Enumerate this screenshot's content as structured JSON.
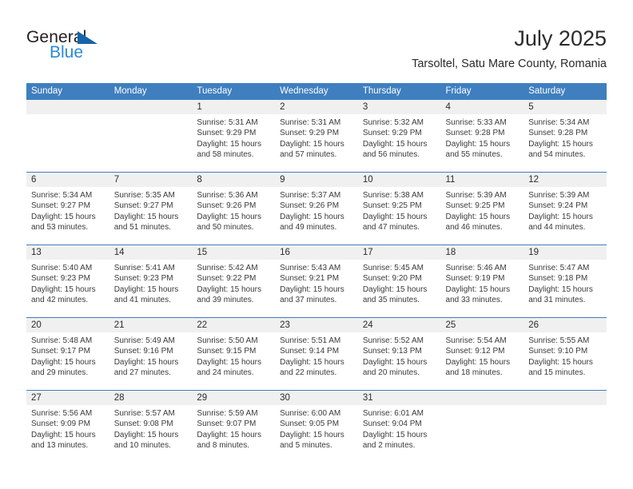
{
  "brand": {
    "name_top": "General",
    "name_bottom": "Blue",
    "triangle_icon": "brand-triangle-icon",
    "color_black": "#231f20",
    "color_blue": "#2a8ad4"
  },
  "header": {
    "title": "July 2025",
    "location": "Tarsoltel, Satu Mare County, Romania"
  },
  "theme": {
    "header_blue": "#3f7fbf",
    "row_gray": "#f0f0f0",
    "text": "#3a3a3a"
  },
  "weekdays": [
    "Sunday",
    "Monday",
    "Tuesday",
    "Wednesday",
    "Thursday",
    "Friday",
    "Saturday"
  ],
  "weeks": [
    [
      {
        "day": "",
        "sunrise": "",
        "sunset": "",
        "daylight_line1": "",
        "daylight_line2": ""
      },
      {
        "day": "",
        "sunrise": "",
        "sunset": "",
        "daylight_line1": "",
        "daylight_line2": ""
      },
      {
        "day": "1",
        "sunrise": "Sunrise: 5:31 AM",
        "sunset": "Sunset: 9:29 PM",
        "daylight_line1": "Daylight: 15 hours",
        "daylight_line2": "and 58 minutes."
      },
      {
        "day": "2",
        "sunrise": "Sunrise: 5:31 AM",
        "sunset": "Sunset: 9:29 PM",
        "daylight_line1": "Daylight: 15 hours",
        "daylight_line2": "and 57 minutes."
      },
      {
        "day": "3",
        "sunrise": "Sunrise: 5:32 AM",
        "sunset": "Sunset: 9:29 PM",
        "daylight_line1": "Daylight: 15 hours",
        "daylight_line2": "and 56 minutes."
      },
      {
        "day": "4",
        "sunrise": "Sunrise: 5:33 AM",
        "sunset": "Sunset: 9:28 PM",
        "daylight_line1": "Daylight: 15 hours",
        "daylight_line2": "and 55 minutes."
      },
      {
        "day": "5",
        "sunrise": "Sunrise: 5:34 AM",
        "sunset": "Sunset: 9:28 PM",
        "daylight_line1": "Daylight: 15 hours",
        "daylight_line2": "and 54 minutes."
      }
    ],
    [
      {
        "day": "6",
        "sunrise": "Sunrise: 5:34 AM",
        "sunset": "Sunset: 9:27 PM",
        "daylight_line1": "Daylight: 15 hours",
        "daylight_line2": "and 53 minutes."
      },
      {
        "day": "7",
        "sunrise": "Sunrise: 5:35 AM",
        "sunset": "Sunset: 9:27 PM",
        "daylight_line1": "Daylight: 15 hours",
        "daylight_line2": "and 51 minutes."
      },
      {
        "day": "8",
        "sunrise": "Sunrise: 5:36 AM",
        "sunset": "Sunset: 9:26 PM",
        "daylight_line1": "Daylight: 15 hours",
        "daylight_line2": "and 50 minutes."
      },
      {
        "day": "9",
        "sunrise": "Sunrise: 5:37 AM",
        "sunset": "Sunset: 9:26 PM",
        "daylight_line1": "Daylight: 15 hours",
        "daylight_line2": "and 49 minutes."
      },
      {
        "day": "10",
        "sunrise": "Sunrise: 5:38 AM",
        "sunset": "Sunset: 9:25 PM",
        "daylight_line1": "Daylight: 15 hours",
        "daylight_line2": "and 47 minutes."
      },
      {
        "day": "11",
        "sunrise": "Sunrise: 5:39 AM",
        "sunset": "Sunset: 9:25 PM",
        "daylight_line1": "Daylight: 15 hours",
        "daylight_line2": "and 46 minutes."
      },
      {
        "day": "12",
        "sunrise": "Sunrise: 5:39 AM",
        "sunset": "Sunset: 9:24 PM",
        "daylight_line1": "Daylight: 15 hours",
        "daylight_line2": "and 44 minutes."
      }
    ],
    [
      {
        "day": "13",
        "sunrise": "Sunrise: 5:40 AM",
        "sunset": "Sunset: 9:23 PM",
        "daylight_line1": "Daylight: 15 hours",
        "daylight_line2": "and 42 minutes."
      },
      {
        "day": "14",
        "sunrise": "Sunrise: 5:41 AM",
        "sunset": "Sunset: 9:23 PM",
        "daylight_line1": "Daylight: 15 hours",
        "daylight_line2": "and 41 minutes."
      },
      {
        "day": "15",
        "sunrise": "Sunrise: 5:42 AM",
        "sunset": "Sunset: 9:22 PM",
        "daylight_line1": "Daylight: 15 hours",
        "daylight_line2": "and 39 minutes."
      },
      {
        "day": "16",
        "sunrise": "Sunrise: 5:43 AM",
        "sunset": "Sunset: 9:21 PM",
        "daylight_line1": "Daylight: 15 hours",
        "daylight_line2": "and 37 minutes."
      },
      {
        "day": "17",
        "sunrise": "Sunrise: 5:45 AM",
        "sunset": "Sunset: 9:20 PM",
        "daylight_line1": "Daylight: 15 hours",
        "daylight_line2": "and 35 minutes."
      },
      {
        "day": "18",
        "sunrise": "Sunrise: 5:46 AM",
        "sunset": "Sunset: 9:19 PM",
        "daylight_line1": "Daylight: 15 hours",
        "daylight_line2": "and 33 minutes."
      },
      {
        "day": "19",
        "sunrise": "Sunrise: 5:47 AM",
        "sunset": "Sunset: 9:18 PM",
        "daylight_line1": "Daylight: 15 hours",
        "daylight_line2": "and 31 minutes."
      }
    ],
    [
      {
        "day": "20",
        "sunrise": "Sunrise: 5:48 AM",
        "sunset": "Sunset: 9:17 PM",
        "daylight_line1": "Daylight: 15 hours",
        "daylight_line2": "and 29 minutes."
      },
      {
        "day": "21",
        "sunrise": "Sunrise: 5:49 AM",
        "sunset": "Sunset: 9:16 PM",
        "daylight_line1": "Daylight: 15 hours",
        "daylight_line2": "and 27 minutes."
      },
      {
        "day": "22",
        "sunrise": "Sunrise: 5:50 AM",
        "sunset": "Sunset: 9:15 PM",
        "daylight_line1": "Daylight: 15 hours",
        "daylight_line2": "and 24 minutes."
      },
      {
        "day": "23",
        "sunrise": "Sunrise: 5:51 AM",
        "sunset": "Sunset: 9:14 PM",
        "daylight_line1": "Daylight: 15 hours",
        "daylight_line2": "and 22 minutes."
      },
      {
        "day": "24",
        "sunrise": "Sunrise: 5:52 AM",
        "sunset": "Sunset: 9:13 PM",
        "daylight_line1": "Daylight: 15 hours",
        "daylight_line2": "and 20 minutes."
      },
      {
        "day": "25",
        "sunrise": "Sunrise: 5:54 AM",
        "sunset": "Sunset: 9:12 PM",
        "daylight_line1": "Daylight: 15 hours",
        "daylight_line2": "and 18 minutes."
      },
      {
        "day": "26",
        "sunrise": "Sunrise: 5:55 AM",
        "sunset": "Sunset: 9:10 PM",
        "daylight_line1": "Daylight: 15 hours",
        "daylight_line2": "and 15 minutes."
      }
    ],
    [
      {
        "day": "27",
        "sunrise": "Sunrise: 5:56 AM",
        "sunset": "Sunset: 9:09 PM",
        "daylight_line1": "Daylight: 15 hours",
        "daylight_line2": "and 13 minutes."
      },
      {
        "day": "28",
        "sunrise": "Sunrise: 5:57 AM",
        "sunset": "Sunset: 9:08 PM",
        "daylight_line1": "Daylight: 15 hours",
        "daylight_line2": "and 10 minutes."
      },
      {
        "day": "29",
        "sunrise": "Sunrise: 5:59 AM",
        "sunset": "Sunset: 9:07 PM",
        "daylight_line1": "Daylight: 15 hours",
        "daylight_line2": "and 8 minutes."
      },
      {
        "day": "30",
        "sunrise": "Sunrise: 6:00 AM",
        "sunset": "Sunset: 9:05 PM",
        "daylight_line1": "Daylight: 15 hours",
        "daylight_line2": "and 5 minutes."
      },
      {
        "day": "31",
        "sunrise": "Sunrise: 6:01 AM",
        "sunset": "Sunset: 9:04 PM",
        "daylight_line1": "Daylight: 15 hours",
        "daylight_line2": "and 2 minutes."
      },
      {
        "day": "",
        "sunrise": "",
        "sunset": "",
        "daylight_line1": "",
        "daylight_line2": ""
      },
      {
        "day": "",
        "sunrise": "",
        "sunset": "",
        "daylight_line1": "",
        "daylight_line2": ""
      }
    ]
  ]
}
